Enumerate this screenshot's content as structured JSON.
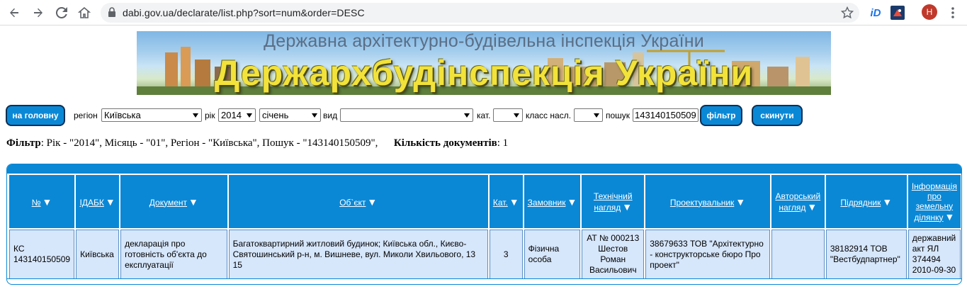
{
  "browser": {
    "url": "dabi.gov.ua/declarate/list.php?sort=num&order=DESC",
    "ext_id_label": "iD",
    "avatar_letter": "Н"
  },
  "banner": {
    "subtitle": "Державна архітектурно-будівельна інспекція України",
    "title": "Держархбудінспекція України"
  },
  "filters": {
    "home_button": "на головну",
    "region_label": "регіон",
    "region_value": "Київська",
    "year_label": "рік",
    "year_value": "2014",
    "month_value": "січень",
    "type_label": "вид",
    "type_value": "",
    "cat_label": "кат.",
    "cat_value": "",
    "class_label": "класс насл.",
    "class_value": "",
    "search_label": "пошук",
    "search_value": "143140150509",
    "filter_button": "фільтр",
    "reset_button": "скинути"
  },
  "summary": {
    "filter_label": "Фільтр",
    "filter_text": ": Рік - \"2014\", Місяць - \"01\", Регіон - \"Київська\", Пошук - \"143140150509\",",
    "count_label": "Кількість документів",
    "count_text": ": 1"
  },
  "table": {
    "headers": [
      "№",
      "ІДАБК",
      "Документ",
      "Об`єкт",
      "Кат.",
      "Замовник",
      "Технічний нагляд",
      "Проектувальник",
      "Авторський нагляд",
      "Підрядник",
      "Інформація про земельну ділянку"
    ],
    "rows": [
      [
        "КС 143140150509",
        "Київська",
        "декларація про готовність об'єкта до експлуатації",
        "Багатоквартирний житловий будинок; Київська обл., Києво-Святошинський р-н, м. Вишневе, вул. Миколи Хвильового, 13 15",
        "3",
        "Фізична особа",
        "АТ № 000213 Шестов Роман Васильович",
        "38679633 ТОВ \"Архітектурно - конструкторське бюро Про проект\"",
        "",
        "38182914 ТОВ \"Вестбудпартнер\"",
        "державний акт ЯЛ 374494 2010-09-30"
      ]
    ]
  },
  "colors": {
    "accent": "#0a88d6",
    "button_border": "#0d2f52",
    "row_bg": "#d6e6fb",
    "banner_title": "#f2e23a"
  }
}
